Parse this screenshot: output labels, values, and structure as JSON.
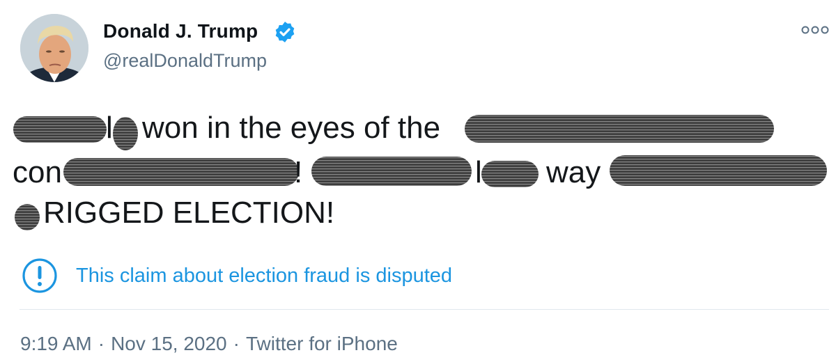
{
  "author": {
    "display_name": "Donald J. Trump",
    "handle": "@realDonaldTrump",
    "verified_icon": "verified-badge-icon",
    "accent_color": "#1da1f2"
  },
  "tweet": {
    "fragments": {
      "l1_a": "l",
      "l1_b": "won in the eyes of the",
      "l2_a": "con",
      "l2_b": "!",
      "l2_c": "l",
      "l2_d": "way",
      "l3_a": "RIGGED ELECTION!"
    },
    "redaction_color": "#4d4d4d"
  },
  "notice": {
    "icon": "exclamation-circle-icon",
    "text": "This claim about election fraud is disputed",
    "color": "#1b95e0"
  },
  "meta": {
    "time": "9:19 AM",
    "date": "Nov 15, 2020",
    "source": "Twitter for iPhone",
    "separator": "·"
  },
  "icons": {
    "more": "more-options-icon",
    "avatar": "profile-avatar"
  }
}
